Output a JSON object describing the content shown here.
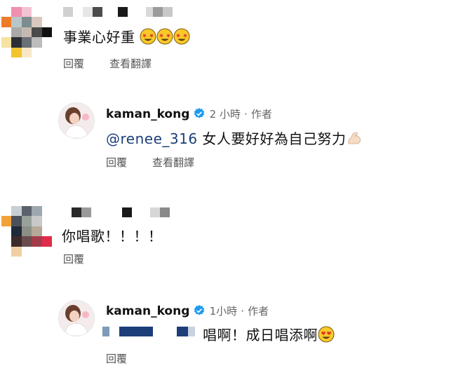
{
  "comments": [
    {
      "text": "事業心好重",
      "actions": {
        "reply": "回覆",
        "translate": "查看翻譯"
      }
    },
    {
      "username": "kaman_kong",
      "time": "2 小時",
      "separator": "·",
      "author_badge": "作者",
      "mention": "@renee_316",
      "text": "女人要好好為自己努力",
      "actions": {
        "reply": "回覆",
        "translate": "查看翻譯"
      }
    },
    {
      "text": "你唱歌！！！！",
      "actions": {
        "reply": "回覆"
      }
    },
    {
      "username": "kaman_kong",
      "time": "1小時",
      "separator": "·",
      "author_badge": "作者",
      "text": "唱啊！成日唱添啊",
      "actions": {
        "reply": "回覆"
      }
    }
  ],
  "colors": {
    "verified": "#1d9bf0",
    "muted": "#666666"
  },
  "icons": [
    "star-struck-emoji",
    "verified-icon",
    "flexed-biceps-emoji",
    "heart-eyes-emoji"
  ]
}
